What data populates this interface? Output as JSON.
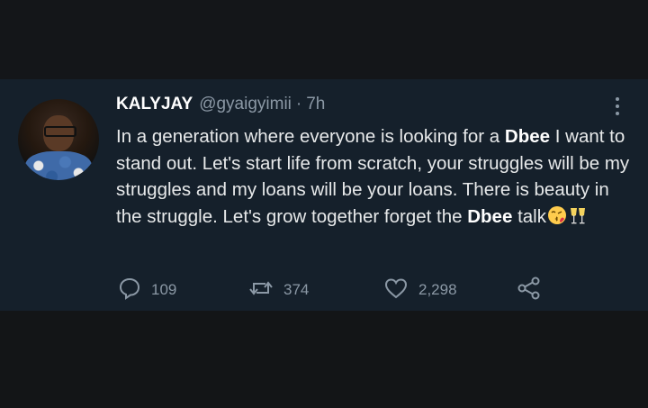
{
  "tweet": {
    "display_name": "KALYJAY",
    "handle": "@gyaigyimii",
    "separator": "·",
    "time": "7h",
    "text_parts": {
      "p1": "In a generation where everyone is looking for a ",
      "bold1": "Dbee",
      "p2": " I want to stand out. Let's start life from scratch, your struggles will be my struggles and my loans will be your loans. There is beauty in the struggle. Let's grow together forget the ",
      "bold2": "Dbee",
      "p3": " talk"
    },
    "emojis": [
      "face-blowing-kiss",
      "clinking-glasses"
    ],
    "stats": {
      "replies": "109",
      "retweets": "374",
      "likes": "2,298"
    }
  },
  "icons": [
    "reply-icon",
    "retweet-icon",
    "like-icon",
    "share-icon",
    "more-options-icon"
  ],
  "colors": {
    "tweet_background": "#15202b",
    "primary_text": "#e7e9ea",
    "secondary_text": "#8b98a5",
    "outer_background": "#141619"
  }
}
